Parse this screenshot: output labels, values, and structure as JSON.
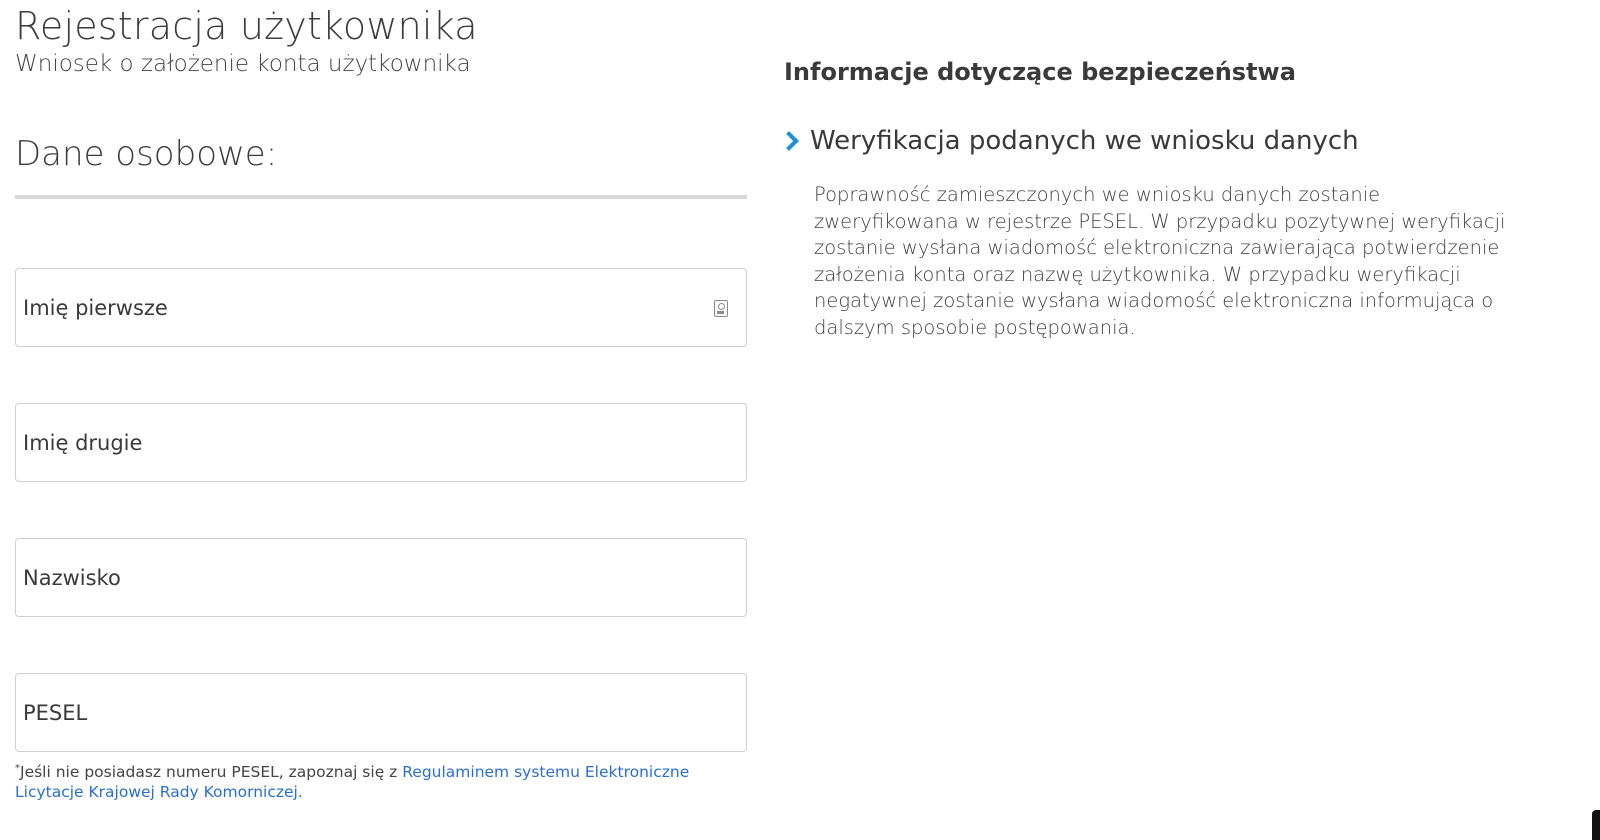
{
  "header": {
    "title": "Rejestracja użytkownika",
    "subtitle": "Wniosek o założenie konta użytkownika"
  },
  "form": {
    "section_title": "Dane osobowe:",
    "fields": [
      {
        "name": "first-name",
        "placeholder": "Imię pierwsze",
        "value": "",
        "icon": "contact-card-icon"
      },
      {
        "name": "second-name",
        "placeholder": "Imię drugie",
        "value": ""
      },
      {
        "name": "surname",
        "placeholder": "Nazwisko",
        "value": ""
      },
      {
        "name": "pesel",
        "placeholder": "PESEL",
        "value": ""
      }
    ],
    "note": {
      "asterisk": "*",
      "text": "Jeśli nie posiadasz numeru PESEL, zapoznaj się z ",
      "link": "Regulaminem systemu Elektroniczne Licytacje Krajowej Rady Komorniczej."
    }
  },
  "info": {
    "title": "Informacje dotyczące bezpieczeństwa",
    "accordion": {
      "icon": "chevron-right-icon",
      "heading": "Weryfikacja podanych we wniosku danych",
      "body": "Poprawność zamieszczonych we wniosku danych zostanie zweryfikowana w rejestrze PESEL. W przypadku pozytywnej weryfikacji zostanie wysłana wiadomość elektroniczna zawierająca potwierdzenie założenia konta oraz nazwę użytkownika. W przypadku weryfikacji negatywnej zostanie wysłana wiadomość elektroniczna informująca o dalszym sposobie postępowania."
    }
  },
  "colors": {
    "accent": "#1e8fd6",
    "link": "#2a6fcf",
    "border": "#cfcfcf",
    "rule": "#d9d9d9"
  }
}
